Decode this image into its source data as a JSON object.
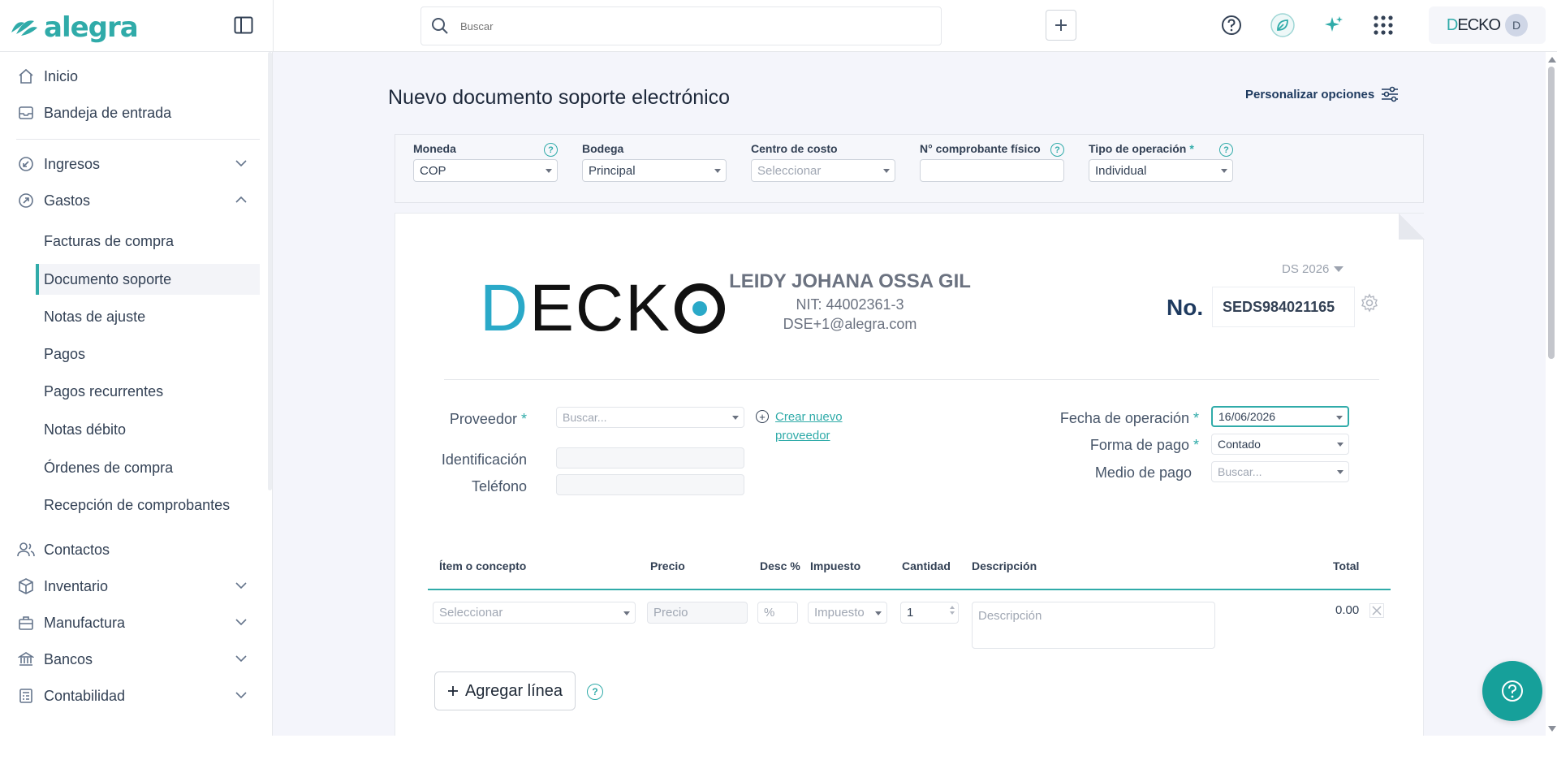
{
  "app": {
    "brand": "alegra",
    "accent": "#30aba9"
  },
  "topbar": {
    "search_placeholder": "Buscar",
    "icons": [
      "sidebar-toggle-icon",
      "search-icon",
      "plus-icon",
      "help-icon",
      "leaf-icon",
      "sparkle-icon",
      "apps-grid-icon"
    ],
    "company": {
      "first_letter": "D",
      "rest": "ECKO",
      "avatar_initial": "D"
    }
  },
  "sidebar": {
    "items": [
      {
        "label": "Inicio",
        "icon": "home-icon"
      },
      {
        "label": "Bandeja de entrada",
        "icon": "inbox-icon"
      },
      {
        "label": "Ingresos",
        "icon": "income-icon"
      },
      {
        "label": "Gastos",
        "icon": "expense-icon"
      },
      {
        "label": "Contactos",
        "icon": "contacts-icon"
      },
      {
        "label": "Inventario",
        "icon": "inventory-icon"
      },
      {
        "label": "Manufactura",
        "icon": "manufacturing-icon"
      },
      {
        "label": "Bancos",
        "icon": "bank-icon"
      },
      {
        "label": "Contabilidad",
        "icon": "accounting-icon"
      }
    ],
    "gastos_sub": [
      "Facturas de compra",
      "Documento soporte",
      "Notas de ajuste",
      "Pagos",
      "Pagos recurrentes",
      "Notas débito",
      "Órdenes de compra",
      "Recepción de comprobantes"
    ],
    "active_sub": "Documento soporte"
  },
  "page": {
    "title": "Nuevo documento soporte electrónico",
    "customize_label": "Personalizar opciones"
  },
  "filters": {
    "moneda": {
      "label": "Moneda",
      "value": "COP"
    },
    "bodega": {
      "label": "Bodega",
      "value": "Principal"
    },
    "centro": {
      "label": "Centro de costo",
      "placeholder": "Seleccionar"
    },
    "comprobante": {
      "label": "N° comprobante físico",
      "value": ""
    },
    "tipo": {
      "label": "Tipo de operación",
      "required_mark": "*",
      "value": "Individual"
    }
  },
  "document": {
    "logo_text": {
      "d": "D",
      "rest": "ECK"
    },
    "issuer": {
      "name": "LEIDY JOHANA OSSA GIL",
      "nit": "NIT: 44002361-3",
      "email": "DSE+1@alegra.com"
    },
    "series": "DS 2026",
    "number_label": "No.",
    "number": "SEDS984021165"
  },
  "form": {
    "proveedor": {
      "label": "Proveedor",
      "required_mark": "*",
      "placeholder": "Buscar..."
    },
    "create_provider": "Crear nuevo proveedor",
    "create_provider_line1": "Crear nuevo",
    "create_provider_line2": "proveedor",
    "identificacion": {
      "label": "Identificación"
    },
    "telefono": {
      "label": "Teléfono"
    },
    "fecha": {
      "label": "Fecha de operación",
      "required_mark": "*",
      "value": "16/06/2026"
    },
    "forma_pago": {
      "label": "Forma de pago",
      "required_mark": "*",
      "value": "Contado"
    },
    "medio_pago": {
      "label": "Medio de pago",
      "placeholder": "Buscar..."
    }
  },
  "items_table": {
    "headers": [
      "Ítem o concepto",
      "Precio",
      "Desc %",
      "Impuesto",
      "Cantidad",
      "Descripción",
      "Total"
    ],
    "row": {
      "item_placeholder": "Seleccionar",
      "price_placeholder": "Precio",
      "discount_placeholder": "%",
      "tax_placeholder": "Impuesto",
      "quantity": "1",
      "description_placeholder": "Descripción",
      "total": "0.00"
    },
    "add_line_label": "Agregar línea"
  }
}
